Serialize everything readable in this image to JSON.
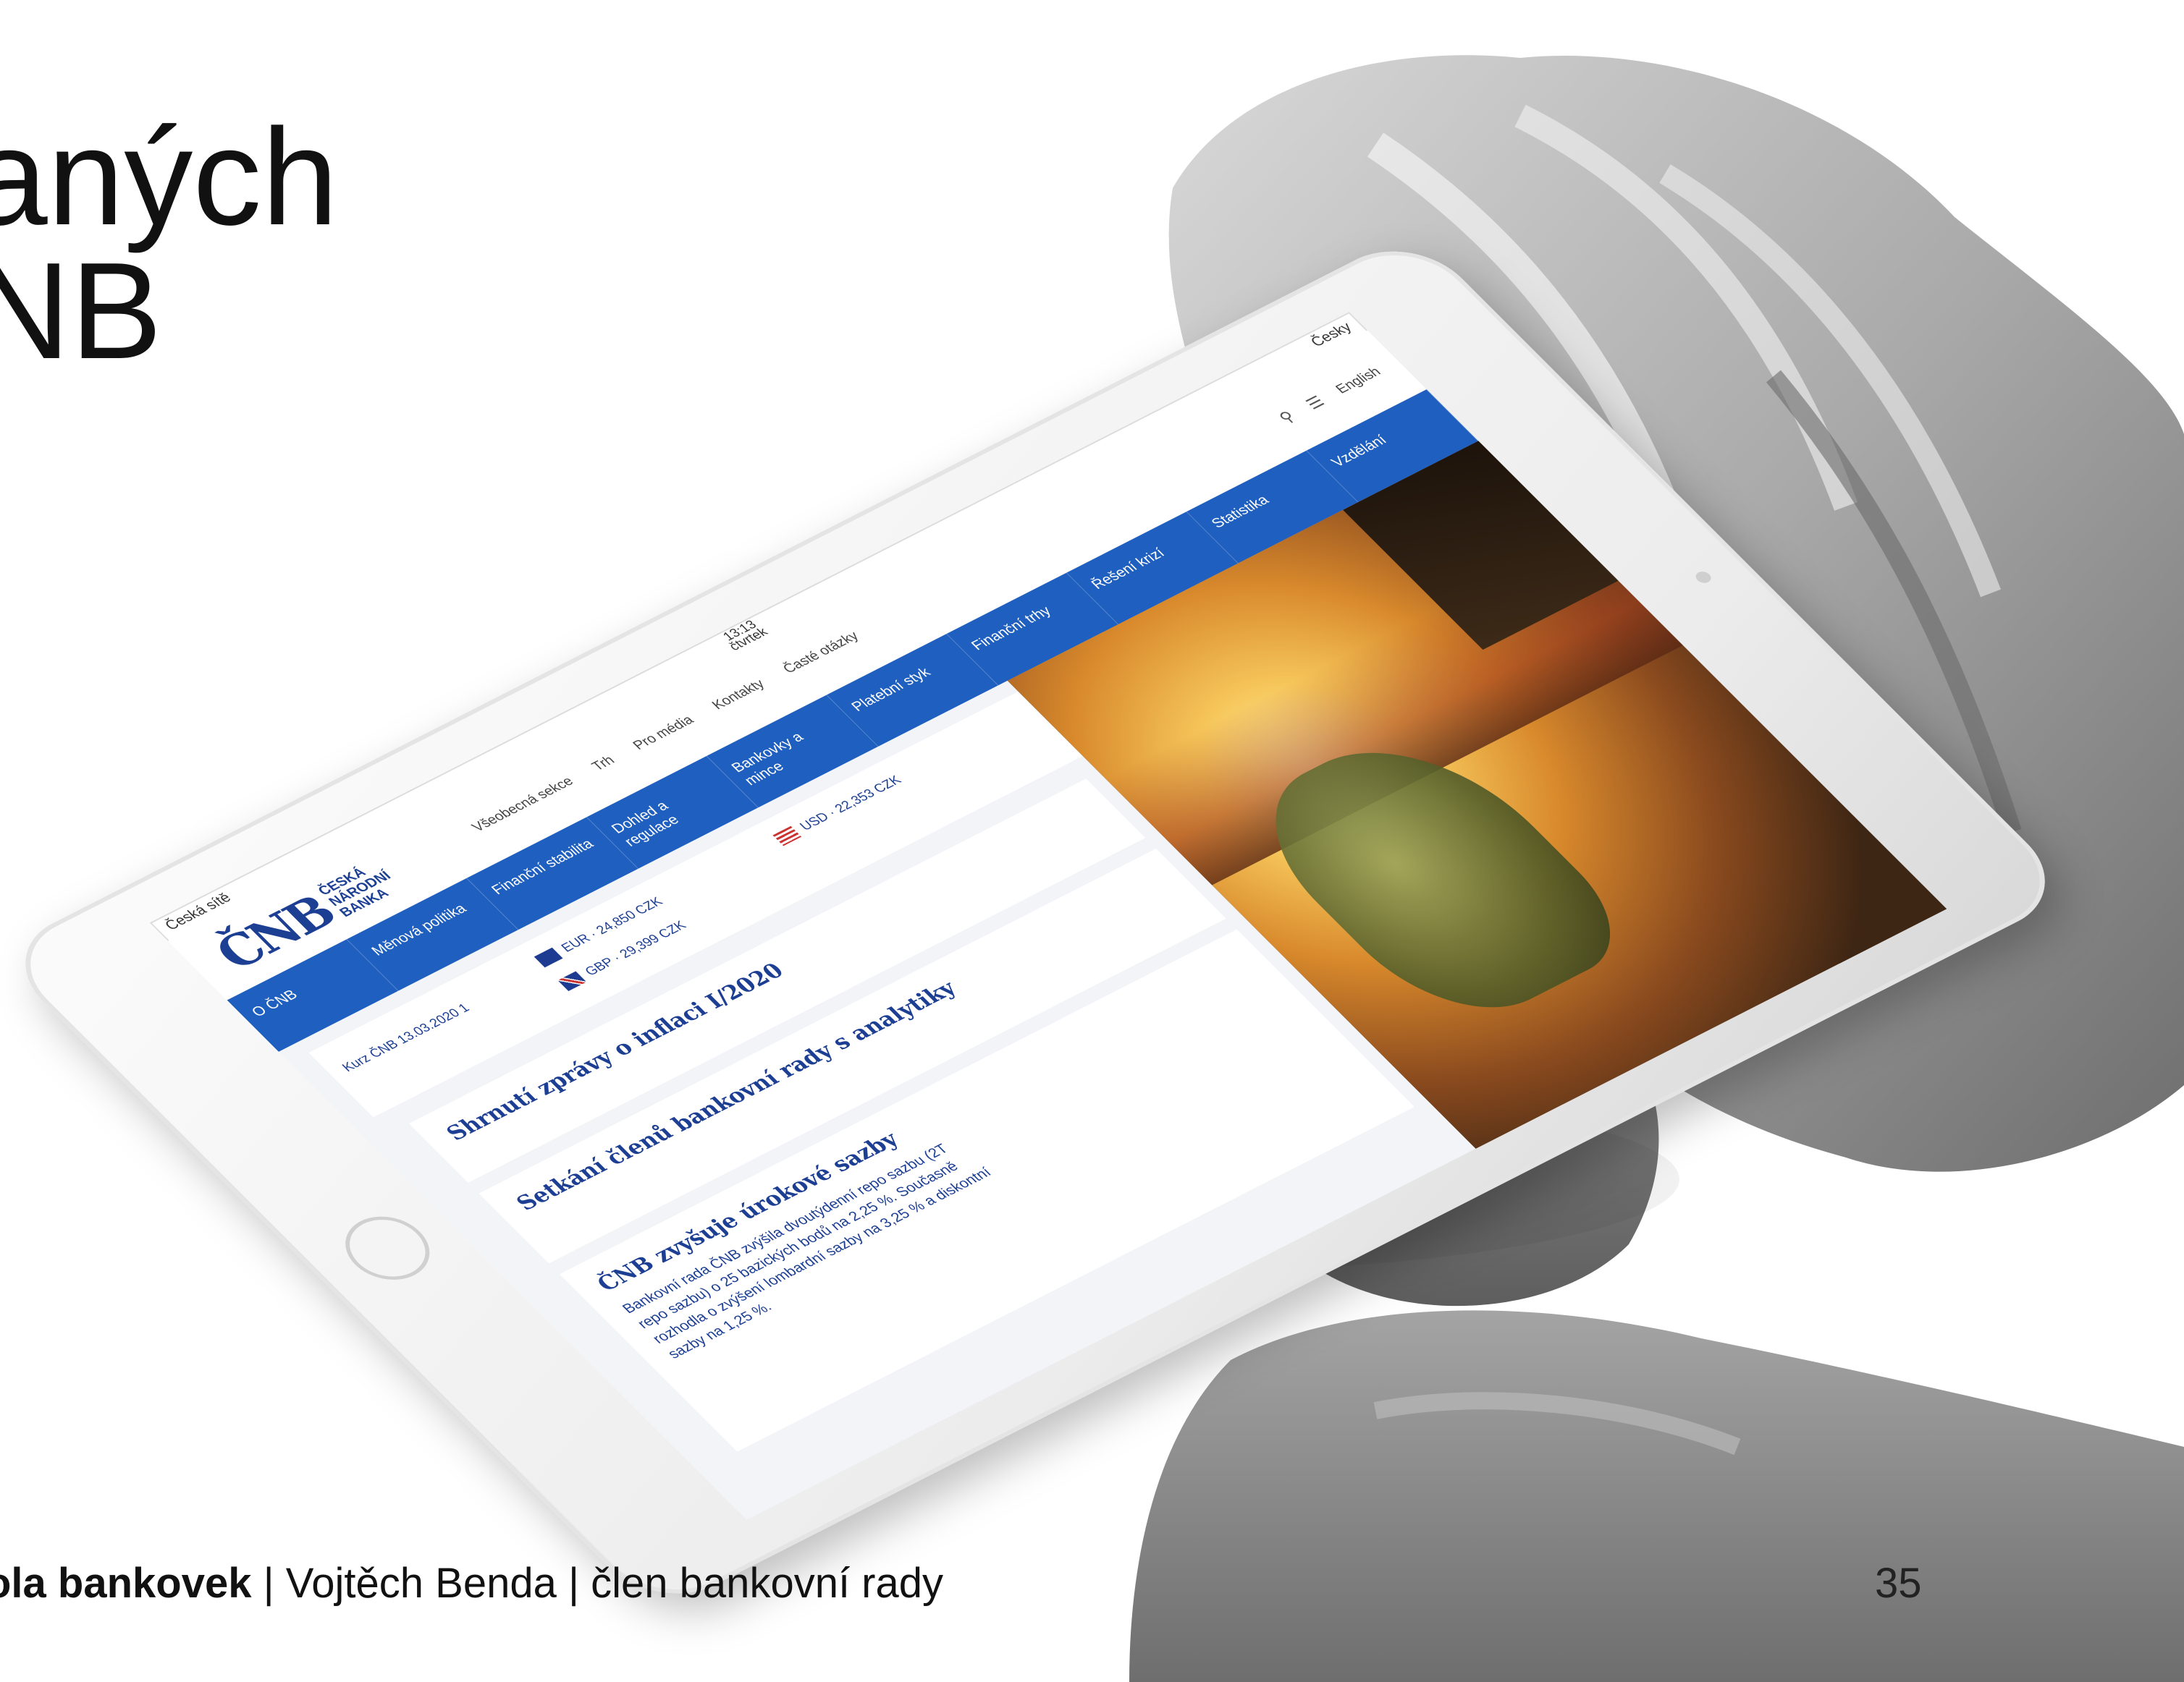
{
  "title": {
    "line1": "aných",
    "line2": "NB"
  },
  "footer": {
    "bold": "ola bankovek",
    "rest": " | Vojtěch Benda | člen bankovní rady",
    "page_number": "35"
  },
  "tablet": {
    "status_bar": {
      "left": "Česká sítě",
      "center_time": "13:13",
      "center_date": "čtvrtek",
      "right": "Česky"
    },
    "logo": {
      "mark": "ČNB",
      "text": "ČESKÁ NÁRODNÍ BANKA"
    },
    "top_links": [
      "Všeobecná sekce",
      "Trh",
      "Pro média",
      "Kontakty",
      "Časté otázky"
    ],
    "search_label": "English",
    "nav_items": [
      "O ČNB",
      "Měnová politika",
      "Finanční stabilita",
      "Dohled a regulace",
      "Bankovky a mince",
      "Platební styk",
      "Finanční trhy",
      "Řešení krizí",
      "Statistika",
      "Vzdělání"
    ],
    "rates": {
      "date_label": "Kurz ČNB 13.03.2020 1",
      "row_eur": "EUR · 24,850 CZK",
      "row_usd": "USD · 22,353 CZK",
      "row_gbp": "GBP · 29,399 CZK"
    },
    "articles": [
      {
        "title": "Shrnutí zprávy o inflaci I/2020",
        "text": ""
      },
      {
        "title": "Setkání členů bankovní rady s analytiky",
        "text": ""
      },
      {
        "title": "ČNB zvyšuje úrokové sazby",
        "text": "Bankovní rada ČNB zvýšila dvoutýdenní repo sazbu (2T repo sazbu) o 25 bazických bodů na 2,25 %. Současně rozhodla o zvýšení lombardní sazby na 3,25 % a diskontní sazby na 1,25 %."
      }
    ]
  },
  "colors": {
    "nav_blue": "#1f5fbf",
    "brand_blue": "#1c3f94",
    "statue_grey": "#8f8f8f"
  }
}
